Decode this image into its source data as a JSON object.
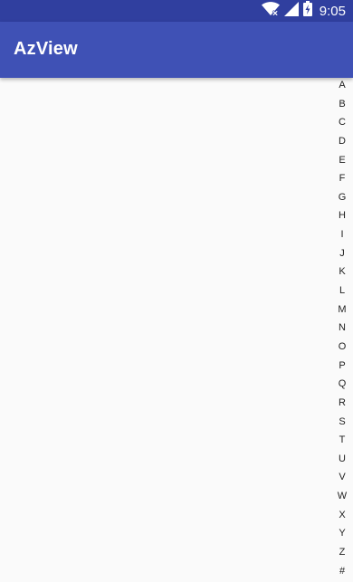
{
  "status_bar": {
    "time": "9:05",
    "icons": [
      "wifi-icon",
      "signal-icon",
      "battery-icon"
    ],
    "background": "#303f9f"
  },
  "app_bar": {
    "title": "AzView",
    "background": "#3f51b5"
  },
  "index_bar": {
    "letters": [
      "A",
      "B",
      "C",
      "D",
      "E",
      "F",
      "G",
      "H",
      "I",
      "J",
      "K",
      "L",
      "M",
      "N",
      "O",
      "P",
      "Q",
      "R",
      "S",
      "T",
      "U",
      "V",
      "W",
      "X",
      "Y",
      "Z",
      "#"
    ]
  }
}
